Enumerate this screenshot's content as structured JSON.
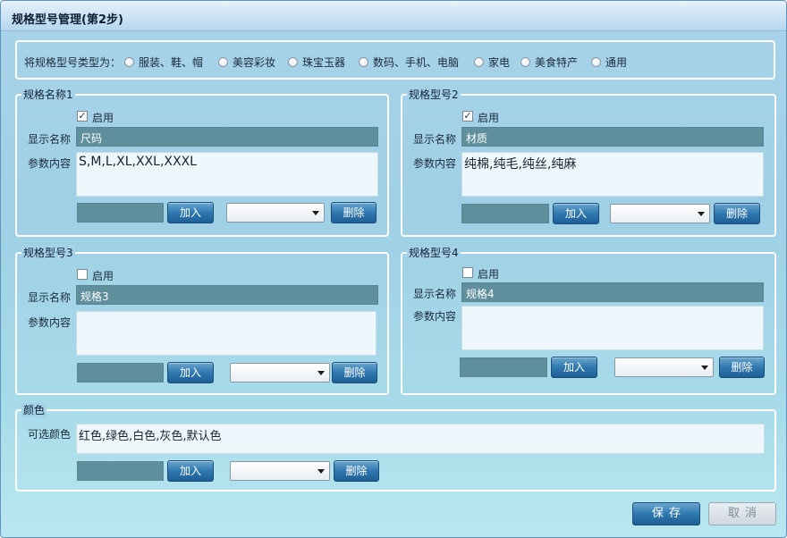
{
  "window": {
    "title": "规格型号管理(第2步)"
  },
  "type_selector": {
    "label": "将规格型号类型为：",
    "options": [
      "服装、鞋、帽",
      "美容彩妆",
      "珠宝玉器",
      "数码、手机、电脑",
      "家电",
      "美食特产",
      "通用"
    ]
  },
  "spec1": {
    "legend": "规格名称1",
    "enable_label": "启用",
    "enabled": true,
    "display_name_label": "显示名称",
    "display_name": "尺码",
    "params_label": "参数内容",
    "params": "S,M,L,XL,XXL,XXXL",
    "add_label": "加入",
    "delete_label": "删除"
  },
  "spec2": {
    "legend": "规格型号2",
    "enable_label": "启用",
    "enabled": true,
    "display_name_label": "显示名称",
    "display_name": "材质",
    "params_label": "参数内容",
    "params": "纯棉,纯毛,纯丝,纯麻",
    "add_label": "加入",
    "delete_label": "删除"
  },
  "spec3": {
    "legend": "规格型号3",
    "enable_label": "启用",
    "enabled": false,
    "display_name_label": "显示名称",
    "display_name": "规格3",
    "params_label": "参数内容",
    "params": "",
    "add_label": "加入",
    "delete_label": "删除"
  },
  "spec4": {
    "legend": "规格型号4",
    "enable_label": "启用",
    "enabled": false,
    "display_name_label": "显示名称",
    "display_name": "规格4",
    "params_label": "参数内容",
    "params": "",
    "add_label": "加入",
    "delete_label": "删除"
  },
  "color": {
    "legend": "颜色",
    "options_label": "可选颜色",
    "options": "红色,绿色,白色,灰色,默认色",
    "add_label": "加入",
    "delete_label": "删除"
  },
  "footer": {
    "save_label": "保存",
    "cancel_label": "取消"
  },
  "icons": {
    "checkbox_checked": "checkmark-icon",
    "dropdown": "chevron-down-icon",
    "radio": "radio-icon"
  }
}
